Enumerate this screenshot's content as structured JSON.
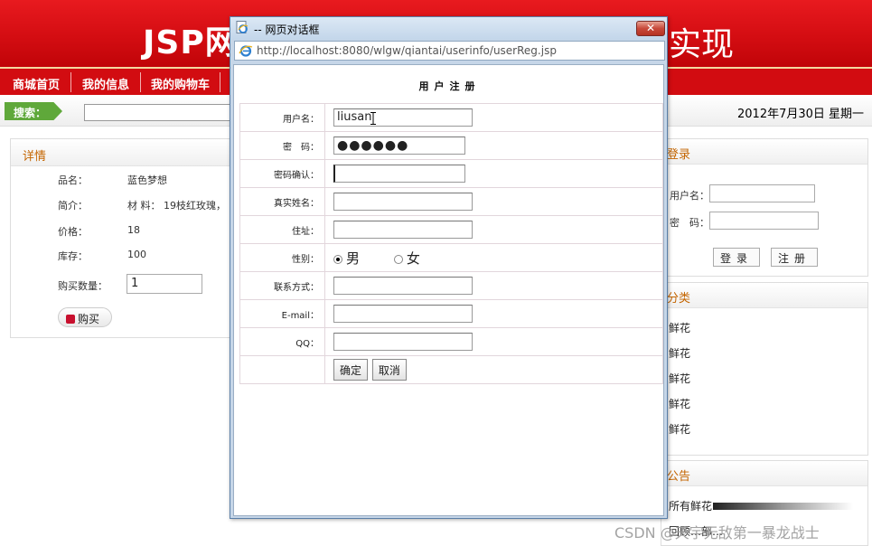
{
  "page": {
    "banner": {
      "title_visible_left": "JSP网",
      "title_visible_right": "实现"
    },
    "nav": [
      "商城首页",
      "我的信息",
      "我的购物车"
    ],
    "search": {
      "label": "搜索：",
      "value": ""
    },
    "date": "2012年7月30日 星期一",
    "detail": {
      "heading": "详情",
      "rows": [
        {
          "label": "品名：",
          "value": "蓝色梦想"
        },
        {
          "label": "简介：",
          "value": "材 料： 19枝红玫瑰，"
        },
        {
          "label": "价格：",
          "value": "18"
        },
        {
          "label": "库存：",
          "value": "100"
        }
      ],
      "qty_label": "购买数量：",
      "qty_value": "1",
      "buy_button": "购买"
    },
    "login": {
      "heading": "登录",
      "username_label": "用户名：",
      "password_label": "密　码：",
      "login_button": "登录",
      "register_button": "注册"
    },
    "category": {
      "heading": "分类",
      "items": [
        "鲜花",
        "鲜花",
        "鲜花",
        "鲜花",
        "鲜花"
      ]
    },
    "notice": {
      "heading": "公告",
      "items": [
        "所有鲜花",
        "回顾…部…"
      ]
    },
    "watermark": "CSDN @天宇无敌第一暴龙战士"
  },
  "dialog": {
    "title": "-- 网页对话框",
    "close_label": "✕",
    "url": "http://localhost:8080/wlgw/qiantai/userinfo/userReg.jsp",
    "form_title": "用户注册",
    "fields": [
      {
        "label": "用户名：",
        "value": "liusan"
      },
      {
        "label": "密　码：",
        "value": "●●●●●●"
      },
      {
        "label": "密码确认：",
        "value": ""
      },
      {
        "label": "真实姓名：",
        "value": ""
      },
      {
        "label": "住址：",
        "value": ""
      },
      {
        "label": "性别：",
        "options": [
          "男",
          "女"
        ],
        "selected": "男"
      },
      {
        "label": "联系方式：",
        "value": ""
      },
      {
        "label": "E-mail：",
        "value": ""
      },
      {
        "label": "QQ：",
        "value": ""
      }
    ],
    "confirm_button": "确定",
    "cancel_button": "取消"
  },
  "colors": {
    "banner_red": "#d40d12",
    "nav_red": "#d20c11",
    "search_green": "#5fa83a",
    "heading_orange": "#c46500",
    "dialog_frame": "#c6d6e8",
    "close_red": "#c8493a"
  },
  "icons": [
    "ie-page-icon",
    "ie-address-icon",
    "close-icon",
    "cart-icon",
    "radio-icon",
    "text-cursor-icon"
  ]
}
